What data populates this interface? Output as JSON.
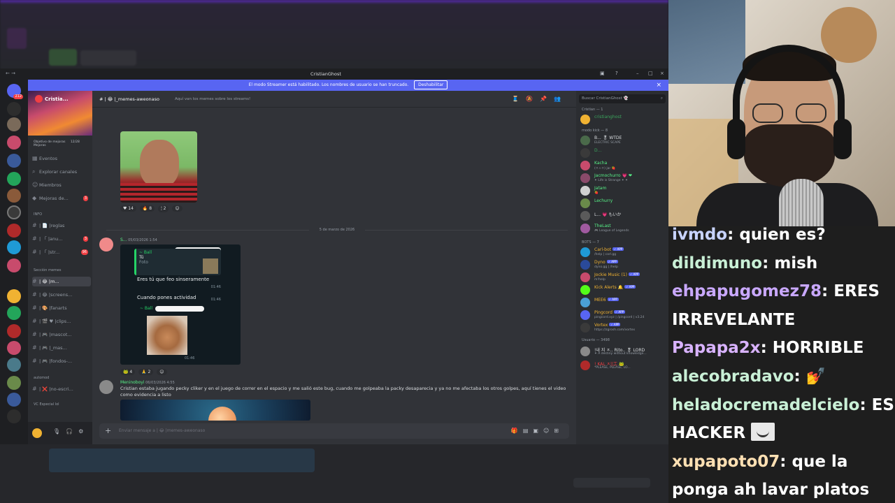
{
  "window": {
    "title": "CristianGhost",
    "streamer_banner": "El modo Streamer está habilitado. Los nombres de usuario se han truncado.",
    "streamer_disable": "Deshabilitar"
  },
  "server": {
    "name": "Cristia...",
    "boost_goal": "Objetivo de mejoras",
    "boost_count": "12/28 Mejoras"
  },
  "channels": {
    "top": [
      {
        "label": "Eventos"
      },
      {
        "label": "Explorar canales"
      },
      {
        "label": "Miembros"
      },
      {
        "label": "Mejoras de...",
        "count": "3"
      }
    ],
    "cat_info": "INFO",
    "info": [
      {
        "label": "| 📄 |reglas"
      },
      {
        "label": "| 「 |anu...",
        "count": "3"
      },
      {
        "label": "| 「 |str...",
        "count": "96"
      }
    ],
    "cat_memes": "Sección memes",
    "memes": [
      {
        "label": "| 😂 |m...",
        "active": true
      },
      {
        "label": "| 😂 |screens..."
      },
      {
        "label": "| 🎨 |fanarts"
      },
      {
        "label": "| 🎬 ♥ |clips..."
      },
      {
        "label": "| 🎮 |mascot..."
      },
      {
        "label": "| 🎮 |_mas..."
      },
      {
        "label": "| 🎮 |fondos-..."
      }
    ],
    "cat_automod": "automod",
    "automod": [
      {
        "label": "| ❌ |no-escri..."
      }
    ],
    "cat_vc": "VC Especial lol"
  },
  "chat": {
    "channel_name": "| 😂 |_memes-aweonaso",
    "topic": "Aquí van los memes sobre los streams!",
    "reactions1": [
      "♥ 14",
      "🔥 8",
      "🕯 2",
      "☺"
    ],
    "date_divider": "5 de marzo de 2026",
    "msg1_author": "S...",
    "msg1_time": "05/03/2026 1:54",
    "wa_reply1_name": "~ Ball",
    "wa_reply1_you": "Tú",
    "wa_reply1_photo": "Foto",
    "wa_text1": "Eres tú que feo sinseramente",
    "wa_time1": "01:46",
    "wa_text2": "Cuando pones actividad",
    "wa_time2": "01:46",
    "wa_reply2_name": "~ Ball",
    "wa_time3": "01:46",
    "reactions2": [
      "🐸 4",
      "🙏 2",
      "☺"
    ],
    "msg2_author": "Meninoboyi",
    "msg2_time": "06/03/2026 4:55",
    "msg2_text": "Cristian estaba jugando pecky cliker y en el juego de correr en el espacio y me salió este bug, cuando me golpeaba la packy desaparecia y ya no me afectaba los otros golpes, aquí tienes el video como evidencia a listo",
    "composer_placeholder": "Enviar mensaje a | 😂 |memes-aweonaso"
  },
  "members": {
    "search_placeholder": "Buscar CristianGhost 👻",
    "group1": "Cristian — 1",
    "group1_members": [
      {
        "name": "cristianghost",
        "color": "#3ba55d"
      }
    ],
    "group2": "modo kick — 8",
    "group2_members": [
      {
        "name": "B... 🎖 WTDE",
        "sub": "ELECTRIC SCAPE",
        "color": "#dbdee1"
      },
      {
        "name": "D...",
        "sub": "",
        "color": "#3ba55d"
      },
      {
        "name": "Kacha",
        "sub": "(ㅇㅅㅇ) jar 🍓",
        "color": "#57f287"
      },
      {
        "name": "Jacmochurro 💗 ❤",
        "sub": "✦ Life is Strange ✦ ✦",
        "color": "#57f287"
      },
      {
        "name": "Jatam",
        "sub": "🍓",
        "color": "#57f287"
      },
      {
        "name": "Lechurry",
        "sub": "",
        "color": "#57f287"
      },
      {
        "name": "L... 💗 もいか",
        "sub": "",
        "color": "#dbdee1"
      },
      {
        "name": "TheLast",
        "sub": "🎮 League of Legends",
        "color": "#57f287"
      }
    ],
    "group3": "BOTS — 7",
    "bots": [
      {
        "name": "Carl-bot",
        "sub": "/help | carl.gg",
        "color": "#f0b232"
      },
      {
        "name": "Dyno",
        "sub": "dyno.gg | /help",
        "color": "#f0b232"
      },
      {
        "name": "Jockie Music (1)",
        "sub": "m!help",
        "color": "#f0b232"
      },
      {
        "name": "Kick Alerts 🔔",
        "sub": "",
        "color": "#f0b232"
      },
      {
        "name": "MEE6",
        "sub": "",
        "color": "#f0b232"
      },
      {
        "name": "Pingcord",
        "sub": "pingcord.xyz | /pingcord | v3.24",
        "color": "#f0b232"
      },
      {
        "name": "Vortex",
        "sub": "https://zgrosh.com/vortex",
        "color": "#f0b232"
      }
    ],
    "group4": "Usuario — 3498",
    "group4_members": [
      {
        "name": "!내 지 ㅈ.. Rito.. 🎖 LORD",
        "sub": "✦ A destiny without knowledge...",
        "color": "#dbdee1"
      },
      {
        "name": "! KAL ㅈ||工 🐸",
        "sub": "*PLEASE, PLEASE, LO...",
        "color": "#f23f43"
      }
    ]
  },
  "stream_chat": [
    {
      "user": "ivmdo",
      "color": "#c8d3ff",
      "text": "quien es?"
    },
    {
      "user": "dildimuno",
      "color": "#c9f0d6",
      "text": "mish"
    },
    {
      "user": "ehpapugomez78",
      "color": "#c9a8ff",
      "text": "ERES IRREVELANTE"
    },
    {
      "user": "Papapa2x",
      "color": "#d9b3ff",
      "text": "HORRIBLE"
    },
    {
      "user": "alecobradavo",
      "color": "#c9f0d6",
      "text": "💅"
    },
    {
      "user": "heladocremadelcielo",
      "color": "#c9f0d6",
      "text": "ES HACKER"
    },
    {
      "user": "xupapoto07",
      "color": "#ffe0b3",
      "text": "que la ponga ah lavar platos"
    }
  ]
}
